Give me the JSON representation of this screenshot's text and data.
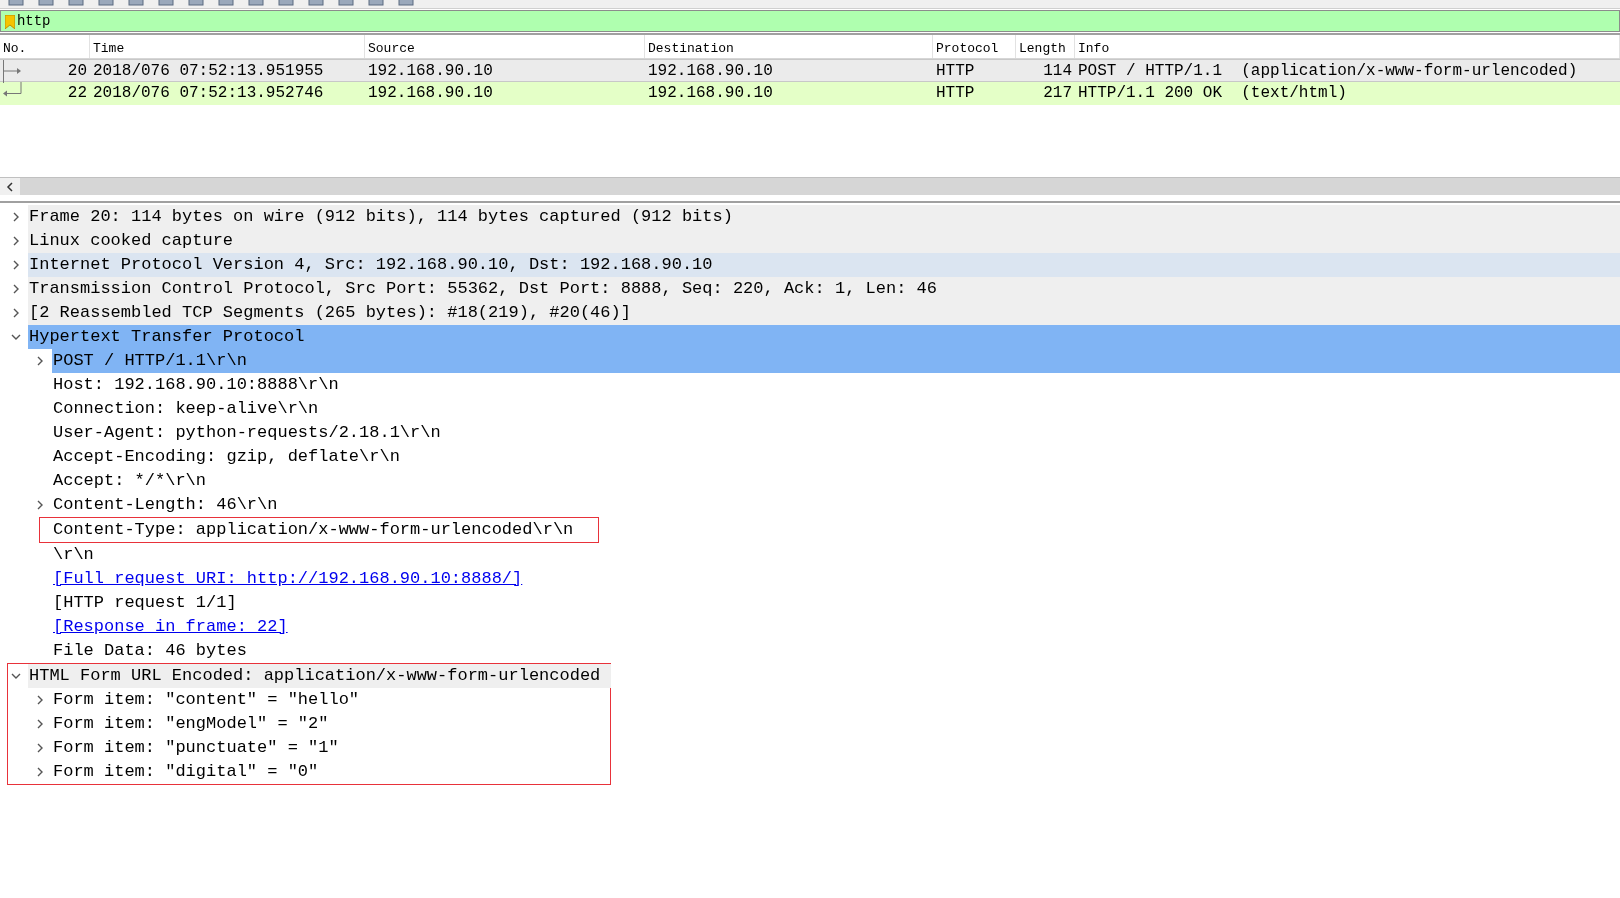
{
  "filter": {
    "value": "http"
  },
  "packet_list": {
    "columns": [
      "No.",
      "Time",
      "Source",
      "Destination",
      "Protocol",
      "Length",
      "Info"
    ],
    "rows": [
      {
        "no": "20",
        "time": "2018/076 07:52:13.951955",
        "source": "192.168.90.10",
        "destination": "192.168.90.10",
        "protocol": "HTTP",
        "length": "114",
        "info": "POST / HTTP/1.1  (application/x-www-form-urlencoded)",
        "kind": "request",
        "selected": true
      },
      {
        "no": "22",
        "time": "2018/076 07:52:13.952746",
        "source": "192.168.90.10",
        "destination": "192.168.90.10",
        "protocol": "HTTP",
        "length": "217",
        "info": "HTTP/1.1 200 OK  (text/html)",
        "kind": "response",
        "selected": false,
        "color": "#e4ffc7"
      }
    ]
  },
  "details": [
    {
      "label": "Frame 20: 114 bytes on wire (912 bits), 114 bytes captured (912 bits)",
      "expanded": false,
      "selected": false,
      "highlighted": false
    },
    {
      "label": "Linux cooked capture",
      "expanded": false,
      "selected": false,
      "highlighted": false
    },
    {
      "label": "Internet Protocol Version 4, Src: 192.168.90.10, Dst: 192.168.90.10",
      "expanded": false,
      "selected": false,
      "highlighted": true
    },
    {
      "label": "Transmission Control Protocol, Src Port: 55362, Dst Port: 8888, Seq: 220, Ack: 1, Len: 46",
      "expanded": false,
      "selected": false,
      "highlighted": false
    },
    {
      "label": "[2 Reassembled TCP Segments (265 bytes): #18(219), #20(46)]",
      "expanded": false,
      "selected": false,
      "highlighted": false
    },
    {
      "label": "Hypertext Transfer Protocol",
      "expanded": true,
      "selected": true,
      "highlighted": false,
      "children": [
        {
          "label": "POST / HTTP/1.1\\r\\n",
          "expanded": false,
          "selected": true,
          "highlighted": false
        },
        {
          "label": "Host: 192.168.90.10:8888\\r\\n",
          "selected": false,
          "highlighted": false
        },
        {
          "label": "Connection: keep-alive\\r\\n",
          "selected": false,
          "highlighted": false
        },
        {
          "label": "User-Agent: python-requests/2.18.1\\r\\n",
          "selected": false,
          "highlighted": false
        },
        {
          "label": "Accept-Encoding: gzip, deflate\\r\\n",
          "selected": false,
          "highlighted": false
        },
        {
          "label": "Accept: */*\\r\\n",
          "selected": false,
          "highlighted": false
        },
        {
          "label": "Content-Length: 46\\r\\n",
          "expanded": false,
          "selected": false,
          "highlighted": false
        },
        {
          "label": "Content-Type: application/x-www-form-urlencoded\\r\\n",
          "selected": false,
          "highlighted": false,
          "boxed": true
        },
        {
          "label": "\\r\\n",
          "selected": false,
          "highlighted": false
        },
        {
          "label": "[Full request URI: http://192.168.90.10:8888/]",
          "kind": "link",
          "selected": false,
          "highlighted": false
        },
        {
          "label": "[HTTP request 1/1]",
          "selected": false,
          "highlighted": false
        },
        {
          "label": "[Response in frame: 22]",
          "kind": "link",
          "selected": false,
          "highlighted": false
        },
        {
          "label": "File Data: 46 bytes",
          "selected": false,
          "highlighted": false
        }
      ]
    },
    {
      "label": "HTML Form URL Encoded: application/x-www-form-urlencoded",
      "expanded": true,
      "selected": false,
      "highlighted": false,
      "boxed": true,
      "children": [
        {
          "label": "Form item: \"content\" = \"hello\"",
          "expanded": false,
          "selected": false,
          "highlighted": false
        },
        {
          "label": "Form item: \"engModel\" = \"2\"",
          "expanded": false,
          "selected": false,
          "highlighted": false
        },
        {
          "label": "Form item: \"punctuate\" = \"1\"",
          "expanded": false,
          "selected": false,
          "highlighted": false
        },
        {
          "label": "Form item: \"digital\" = \"0\"",
          "expanded": false,
          "selected": false,
          "highlighted": false
        }
      ]
    }
  ]
}
